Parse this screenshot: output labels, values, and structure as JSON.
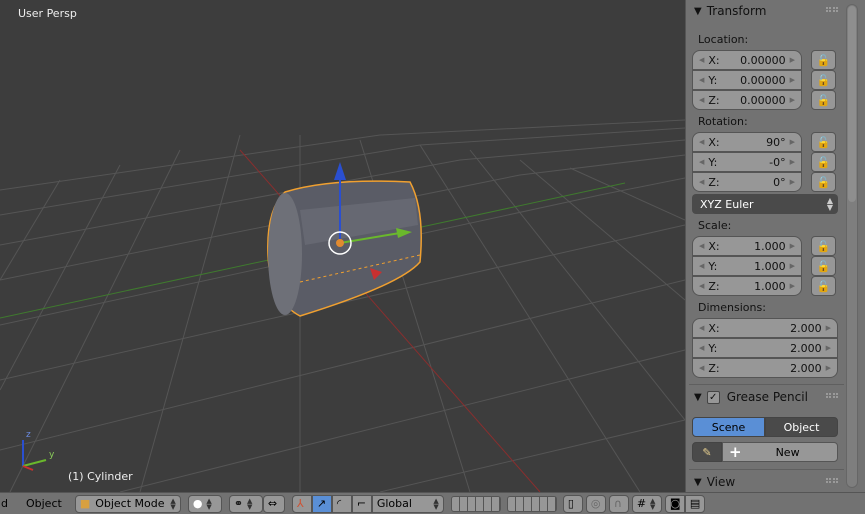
{
  "viewport": {
    "view_name": "User Persp",
    "object_label": "(1) Cylinder",
    "axis_labels": {
      "z": "z",
      "y": "y"
    }
  },
  "transform": {
    "title": "Transform",
    "location": {
      "label": "Location:",
      "x": "0.00000",
      "y": "0.00000",
      "z": "0.00000"
    },
    "rotation": {
      "label": "Rotation:",
      "x": "90°",
      "y": "-0°",
      "z": "0°"
    },
    "rotation_mode": "XYZ Euler",
    "scale": {
      "label": "Scale:",
      "x": "1.000",
      "y": "1.000",
      "z": "1.000"
    },
    "dimensions": {
      "label": "Dimensions:",
      "x": "2.000",
      "y": "2.000",
      "z": "2.000"
    },
    "axis_keys": {
      "x": "X:",
      "y": "Y:",
      "z": "Z:"
    }
  },
  "grease_pencil": {
    "title": "Grease Pencil",
    "checked": true,
    "tabs": [
      "Scene",
      "Object"
    ],
    "active_tab": "Scene",
    "new_label": "New"
  },
  "view_panel": {
    "title": "View"
  },
  "header": {
    "menu_view_partial": "d",
    "menu_object": "Object",
    "mode": "Object Mode",
    "orientation": "Global"
  },
  "colors": {
    "accent": "#5a8fd6",
    "selection": "#f0a030",
    "x_axis": "#c83030",
    "y_axis": "#6ab82c",
    "z_axis": "#2a4fd0"
  }
}
